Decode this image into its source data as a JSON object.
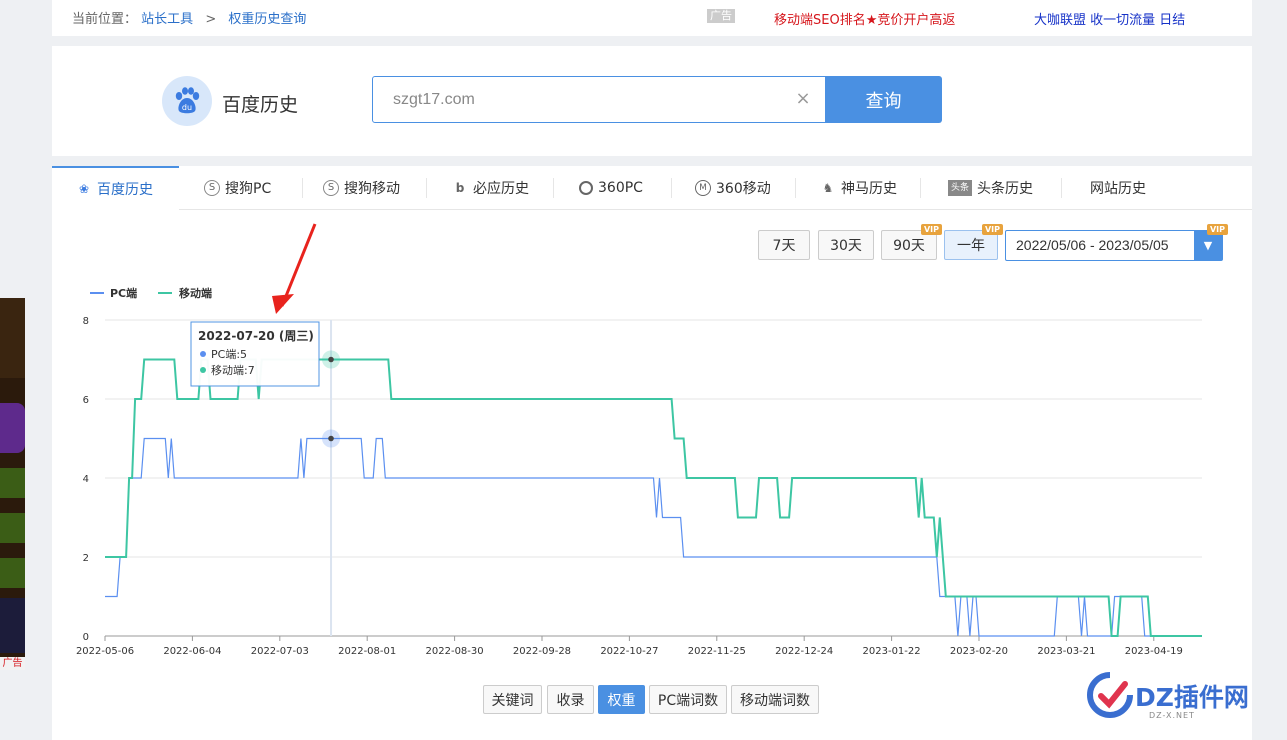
{
  "breadcrumb": {
    "label": "当前位置：",
    "items": [
      "站长工具",
      "权重历史查询"
    ],
    "sep": ">"
  },
  "ads": {
    "tag": "广告",
    "link1": "移动端SEO排名★竞价开户高返",
    "link2": "大咖联盟 收一切流量 日结"
  },
  "search": {
    "engine_label": "百度历史",
    "value": "szgt17.com",
    "button": "查询"
  },
  "tabs": [
    {
      "label": "百度历史",
      "icon": "baidu-paw-icon"
    },
    {
      "label": "搜狗PC",
      "icon": "sogou-icon"
    },
    {
      "label": "搜狗移动",
      "icon": "sogou-icon"
    },
    {
      "label": "必应历史",
      "icon": "bing-icon"
    },
    {
      "label": "360PC",
      "icon": "360-icon"
    },
    {
      "label": "360移动",
      "icon": "360-mobile-icon"
    },
    {
      "label": "神马历史",
      "icon": "shenma-icon"
    },
    {
      "label": "头条历史",
      "icon": "toutiao-icon"
    },
    {
      "label": "网站历史",
      "icon": ""
    }
  ],
  "ranges": [
    "7天",
    "30天",
    "90天",
    "一年"
  ],
  "vip_label": "VIP",
  "date_range": "2022/05/06 - 2023/05/05",
  "tooltip": {
    "title": "2022-07-20 (周三)",
    "line1": "PC端:5",
    "line2": "移动端:7"
  },
  "bottom_buttons": [
    "关键词",
    "收录",
    "权重",
    "PC端词数",
    "移动端词数"
  ],
  "left_ad": {
    "tag": "广告"
  },
  "watermark": {
    "text": "DZ插件网",
    "sub": "DZ-X.NET"
  },
  "colors": {
    "pc": "#5b8ff0",
    "mobile": "#3dc6a3",
    "accent": "#4a90e2",
    "arrow": "#e8231d"
  },
  "chart_data": {
    "type": "line",
    "legend": [
      "PC端",
      "移动端"
    ],
    "ylim": [
      0,
      8
    ],
    "yticks": [
      0,
      2,
      4,
      6,
      8
    ],
    "xticks": [
      "2022-05-06",
      "2022-06-04",
      "2022-07-03",
      "2022-08-01",
      "2022-08-30",
      "2022-09-28",
      "2022-10-27",
      "2022-11-25",
      "2022-12-24",
      "2023-01-22",
      "2023-02-20",
      "2023-03-21",
      "2023-04-19"
    ],
    "series": [
      {
        "name": "PC端",
        "points": [
          [
            "2022-05-06",
            1
          ],
          [
            "2022-05-10",
            1
          ],
          [
            "2022-05-11",
            2
          ],
          [
            "2022-05-13",
            2
          ],
          [
            "2022-05-14",
            4
          ],
          [
            "2022-05-18",
            4
          ],
          [
            "2022-05-19",
            5
          ],
          [
            "2022-05-26",
            5
          ],
          [
            "2022-05-27",
            4
          ],
          [
            "2022-05-28",
            5
          ],
          [
            "2022-05-29",
            4
          ],
          [
            "2022-07-09",
            4
          ],
          [
            "2022-07-10",
            5
          ],
          [
            "2022-07-11",
            4
          ],
          [
            "2022-07-12",
            5
          ],
          [
            "2022-07-30",
            5
          ],
          [
            "2022-07-31",
            4
          ],
          [
            "2022-08-03",
            4
          ],
          [
            "2022-08-04",
            5
          ],
          [
            "2022-08-06",
            5
          ],
          [
            "2022-08-07",
            4
          ],
          [
            "2022-11-04",
            4
          ],
          [
            "2022-11-05",
            3
          ],
          [
            "2022-11-06",
            4
          ],
          [
            "2022-11-07",
            3
          ],
          [
            "2022-11-13",
            3
          ],
          [
            "2022-11-14",
            2
          ],
          [
            "2023-02-06",
            2
          ],
          [
            "2023-02-07",
            1
          ],
          [
            "2023-02-12",
            1
          ],
          [
            "2023-02-13",
            0
          ],
          [
            "2023-02-14",
            1
          ],
          [
            "2023-02-16",
            1
          ],
          [
            "2023-02-17",
            0
          ],
          [
            "2023-02-18",
            1
          ],
          [
            "2023-02-19",
            1
          ],
          [
            "2023-02-20",
            0
          ],
          [
            "2023-03-17",
            0
          ],
          [
            "2023-03-18",
            1
          ],
          [
            "2023-03-25",
            1
          ],
          [
            "2023-03-26",
            0
          ],
          [
            "2023-03-27",
            1
          ],
          [
            "2023-03-28",
            0
          ],
          [
            "2023-04-05",
            0
          ],
          [
            "2023-04-06",
            1
          ],
          [
            "2023-04-15",
            1
          ],
          [
            "2023-04-16",
            0
          ],
          [
            "2023-05-05",
            0
          ]
        ]
      },
      {
        "name": "移动端",
        "points": [
          [
            "2022-05-06",
            2
          ],
          [
            "2022-05-13",
            2
          ],
          [
            "2022-05-14",
            4
          ],
          [
            "2022-05-15",
            4
          ],
          [
            "2022-05-16",
            6
          ],
          [
            "2022-05-18",
            6
          ],
          [
            "2022-05-19",
            7
          ],
          [
            "2022-05-29",
            7
          ],
          [
            "2022-05-30",
            6
          ],
          [
            "2022-06-06",
            6
          ],
          [
            "2022-06-07",
            7
          ],
          [
            "2022-06-09",
            7
          ],
          [
            "2022-06-10",
            6
          ],
          [
            "2022-06-19",
            6
          ],
          [
            "2022-06-20",
            7
          ],
          [
            "2022-06-25",
            7
          ],
          [
            "2022-06-26",
            6
          ],
          [
            "2022-06-27",
            7
          ],
          [
            "2022-08-08",
            7
          ],
          [
            "2022-08-09",
            6
          ],
          [
            "2022-11-10",
            6
          ],
          [
            "2022-11-11",
            5
          ],
          [
            "2022-11-14",
            5
          ],
          [
            "2022-11-15",
            4
          ],
          [
            "2022-12-01",
            4
          ],
          [
            "2022-12-02",
            3
          ],
          [
            "2022-12-08",
            3
          ],
          [
            "2022-12-09",
            4
          ],
          [
            "2022-12-15",
            4
          ],
          [
            "2022-12-16",
            3
          ],
          [
            "2022-12-19",
            3
          ],
          [
            "2022-12-20",
            4
          ],
          [
            "2023-01-30",
            4
          ],
          [
            "2023-01-31",
            3
          ],
          [
            "2023-02-01",
            4
          ],
          [
            "2023-02-02",
            3
          ],
          [
            "2023-02-05",
            3
          ],
          [
            "2023-02-06",
            2
          ],
          [
            "2023-02-07",
            3
          ],
          [
            "2023-02-09",
            1
          ],
          [
            "2023-04-04",
            1
          ],
          [
            "2023-04-05",
            0
          ],
          [
            "2023-04-07",
            0
          ],
          [
            "2023-04-08",
            1
          ],
          [
            "2023-04-17",
            1
          ],
          [
            "2023-04-18",
            0
          ],
          [
            "2023-05-05",
            0
          ]
        ]
      }
    ]
  }
}
